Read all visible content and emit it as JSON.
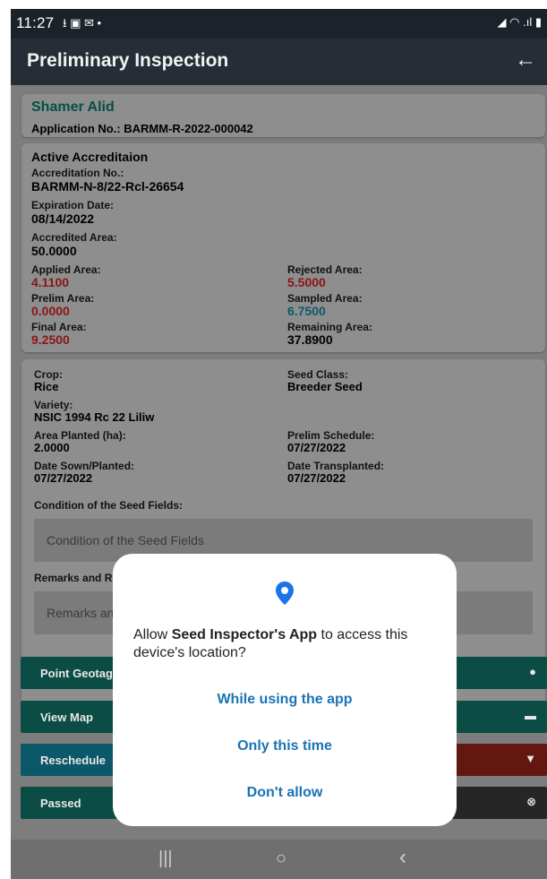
{
  "status_bar": {
    "time": "11:27",
    "left_icons": "⭳ ▣ ✉ •",
    "right_icons": "◢ ◠ .ıl ▮"
  },
  "app_bar": {
    "title": "Preliminary Inspection",
    "back_icon": "←"
  },
  "applicant": {
    "name": "Shamer Alid",
    "application_no": "Application No.: BARMM-R-2022-000042"
  },
  "accreditation": {
    "section_title": "Active Accreditaion",
    "accreditation_no_label": "Accreditation No.:",
    "accreditation_no": "BARMM-N-8/22-Rcl-26654",
    "expiration_label": "Expiration Date:",
    "expiration": "08/14/2022",
    "accredited_area_label": "Accredited Area:",
    "accredited_area": "50.0000",
    "applied_area_label": "Applied Area:",
    "applied_area": "4.1100",
    "rejected_area_label": "Rejected Area:",
    "rejected_area": "5.5000",
    "prelim_area_label": "Prelim Area:",
    "prelim_area": "0.0000",
    "sampled_area_label": "Sampled Area:",
    "sampled_area": "6.7500",
    "final_area_label": "Final Area:",
    "final_area": "9.2500",
    "remaining_area_label": "Remaining Area:",
    "remaining_area": "37.8900"
  },
  "crop_info": {
    "crop_label": "Crop:",
    "crop": "Rice",
    "seed_class_label": "Seed Class:",
    "seed_class": "Breeder Seed",
    "variety_label": "Variety:",
    "variety": "NSIC 1994 Rc 22 Liliw",
    "area_planted_label": "Area Planted (ha):",
    "area_planted": "2.0000",
    "prelim_schedule_label": "Prelim Schedule:",
    "prelim_schedule": "07/27/2022",
    "date_sown_label": "Date Sown/Planted:",
    "date_sown": "07/27/2022",
    "date_transplanted_label": "Date Transplanted:",
    "date_transplanted": "07/27/2022",
    "condition_label": "Condition of the Seed Fields:",
    "condition_placeholder": "Condition of the Seed Fields",
    "remarks_label": "Remarks and Re",
    "remarks_placeholder": "Remarks and"
  },
  "buttons": [
    {
      "label": "Point Geotagg",
      "icon": "map-pin-plus-icon",
      "glyph": "●",
      "color": "#0b4d45"
    },
    {
      "label": "View Map",
      "icon": "image-icon",
      "glyph": "▬",
      "color": "#0b4d45"
    },
    {
      "label": "Reschedule",
      "icon": "thumbs-down-icon",
      "glyph": "▼",
      "color_left": "#0a5868",
      "color_right": "#621710"
    },
    {
      "label": "Passed",
      "icon": "close-circle-icon",
      "glyph": "⊗",
      "color_left": "#0b4d45",
      "color_right": "#262626"
    }
  ],
  "permission_dialog": {
    "message_prefix": "Allow ",
    "app_name": "Seed Inspector's App",
    "message_suffix": " to access this device's location?",
    "option_while_using": "While using the app",
    "option_only_this_time": "Only this time",
    "option_dont_allow": "Don't allow",
    "accent": "#1a73b5"
  },
  "nav_bar": {
    "recents": "|||",
    "home": "○",
    "back": "‹"
  }
}
